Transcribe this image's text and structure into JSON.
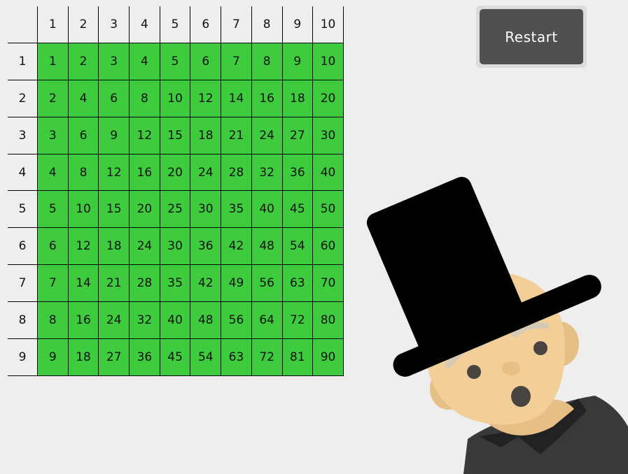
{
  "table": {
    "column_headers": [
      "1",
      "2",
      "3",
      "4",
      "5",
      "6",
      "7",
      "8",
      "9",
      "10"
    ],
    "rows": [
      {
        "header": "1",
        "cells": [
          "1",
          "2",
          "3",
          "4",
          "5",
          "6",
          "7",
          "8",
          "9",
          "10"
        ]
      },
      {
        "header": "2",
        "cells": [
          "2",
          "4",
          "6",
          "8",
          "10",
          "12",
          "14",
          "16",
          "18",
          "20"
        ]
      },
      {
        "header": "3",
        "cells": [
          "3",
          "6",
          "9",
          "12",
          "15",
          "18",
          "21",
          "24",
          "27",
          "30"
        ]
      },
      {
        "header": "4",
        "cells": [
          "4",
          "8",
          "12",
          "16",
          "20",
          "24",
          "28",
          "32",
          "36",
          "40"
        ]
      },
      {
        "header": "5",
        "cells": [
          "5",
          "10",
          "15",
          "20",
          "25",
          "30",
          "35",
          "40",
          "45",
          "50"
        ]
      },
      {
        "header": "6",
        "cells": [
          "6",
          "12",
          "18",
          "24",
          "30",
          "36",
          "42",
          "48",
          "54",
          "60"
        ]
      },
      {
        "header": "7",
        "cells": [
          "7",
          "14",
          "21",
          "28",
          "35",
          "42",
          "49",
          "56",
          "63",
          "70"
        ]
      },
      {
        "header": "8",
        "cells": [
          "8",
          "16",
          "24",
          "32",
          "40",
          "48",
          "56",
          "64",
          "72",
          "80"
        ]
      },
      {
        "header": "9",
        "cells": [
          "9",
          "18",
          "27",
          "36",
          "45",
          "54",
          "63",
          "72",
          "81",
          "90"
        ]
      }
    ],
    "filled_color": "#3ecb3e"
  },
  "controls": {
    "restart_label": "Restart"
  },
  "character": {
    "icon": "top-hat-character-icon",
    "hat_color": "#000000",
    "skin_color": "#f2cf98",
    "shirt_color": "#3a3a3a"
  }
}
